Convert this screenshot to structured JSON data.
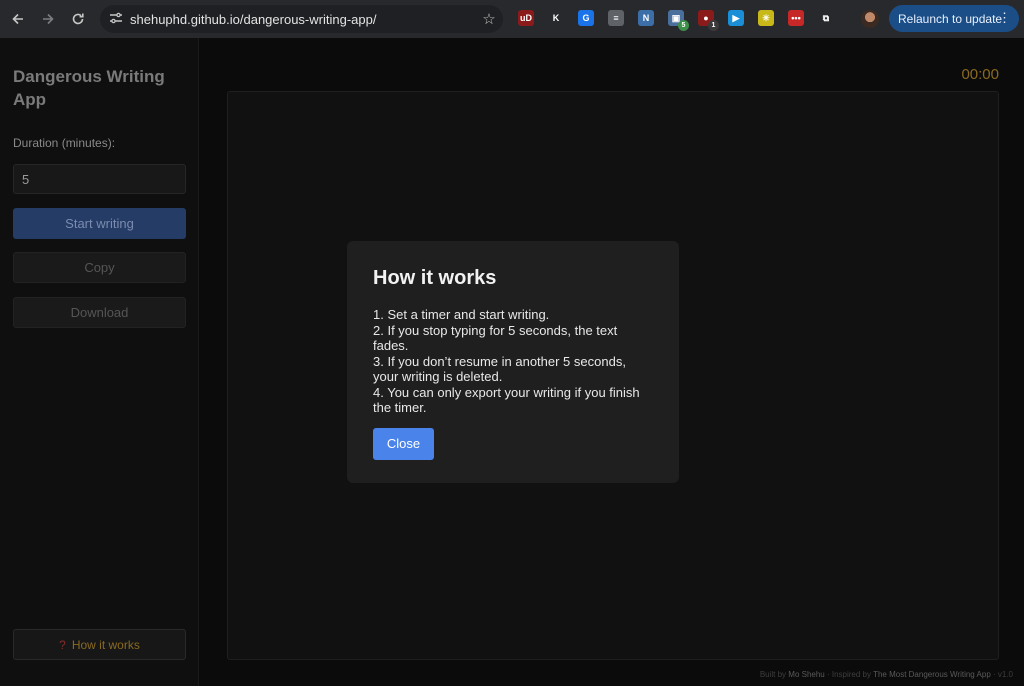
{
  "browser": {
    "url": "shehuphd.github.io/dangerous-writing-app/",
    "relaunch_label": "Relaunch to update",
    "extensions": [
      {
        "name": "ublock-icon",
        "glyph": "uD",
        "color": "#8b1a1a"
      },
      {
        "name": "k-extension-icon",
        "glyph": "K",
        "color": "#28292c"
      },
      {
        "name": "grammar-icon",
        "glyph": "G",
        "color": "#1a73e8"
      },
      {
        "name": "reader-icon",
        "glyph": "≡",
        "color": "#5f6368"
      },
      {
        "name": "notion-icon",
        "glyph": "N",
        "color": "#3c6fa8"
      },
      {
        "name": "tab-manager-icon",
        "glyph": "▣",
        "color": "#4a6f9c",
        "badge": "5"
      },
      {
        "name": "record-icon",
        "glyph": "●",
        "color": "#8b1a1a",
        "badge": "1"
      },
      {
        "name": "play-icon",
        "glyph": "▶",
        "color": "#1a8fd8"
      },
      {
        "name": "sparkle-icon",
        "glyph": "✳",
        "color": "#c9b81a"
      },
      {
        "name": "dots-extension-icon",
        "glyph": "•••",
        "color": "#c62828"
      },
      {
        "name": "puzzle-icon",
        "glyph": "⧉",
        "color": "#28292c"
      }
    ]
  },
  "sidebar": {
    "title": "Dangerous Writing App",
    "duration_label": "Duration (minutes):",
    "duration_value": "5",
    "start_label": "Start writing",
    "copy_label": "Copy",
    "download_label": "Download",
    "how_icon": "?",
    "how_label": "How it works"
  },
  "main": {
    "timer": "00:00"
  },
  "footer": {
    "built_by_prefix": "Built by ",
    "author": "Mo Shehu",
    "inspired_prefix": " · Inspired by ",
    "inspiration": "The Most Dangerous Writing App",
    "version": " · v1.0"
  },
  "modal": {
    "title": "How it works",
    "steps": [
      "1. Set a timer and start writing.",
      "2. If you stop typing for 5 seconds, the text fades.",
      "3. If you don’t resume in another 5 seconds, your writing is deleted.",
      "4. You can only export your writing if you finish the timer."
    ],
    "close_label": "Close"
  }
}
